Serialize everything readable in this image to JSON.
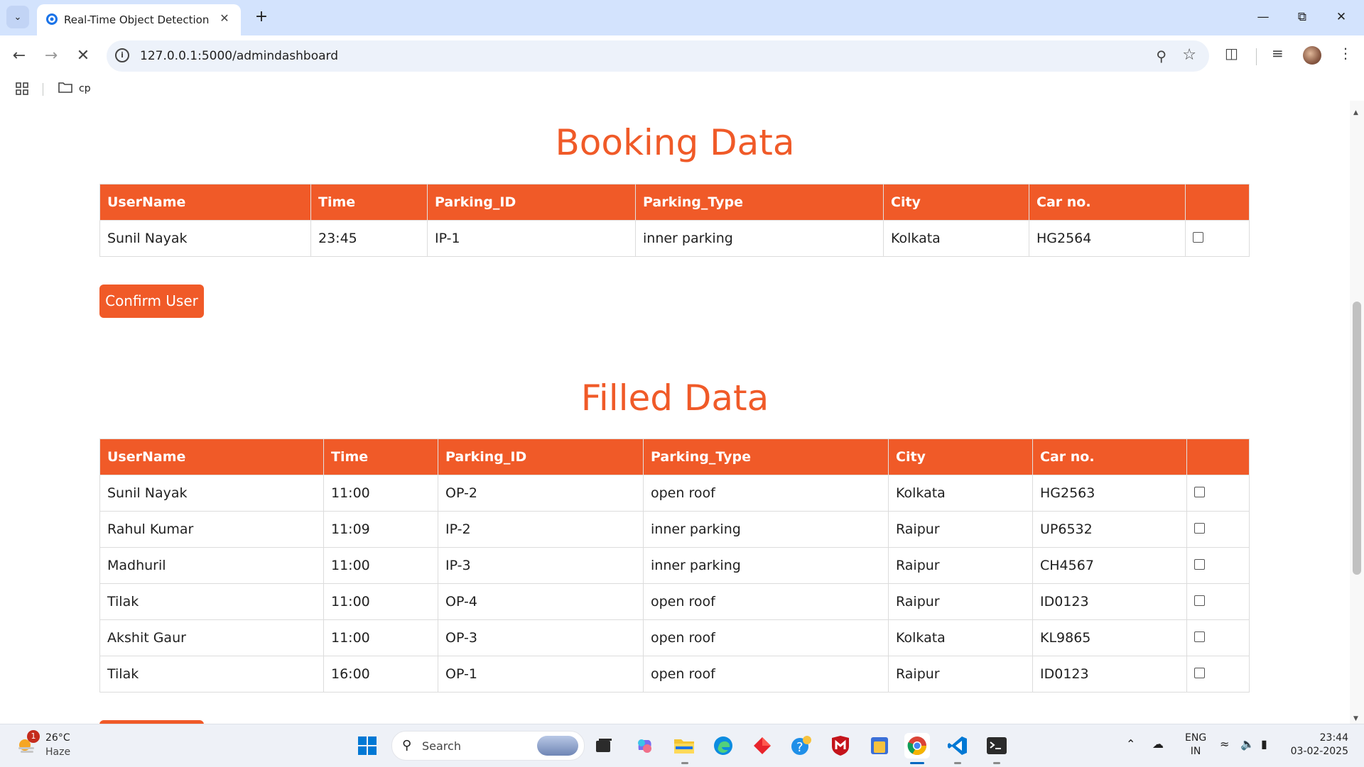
{
  "browser": {
    "tab_title": "Real-Time Object Detection",
    "url": "127.0.0.1:5000/admindashboard",
    "bookmark_folder": "cp"
  },
  "page": {
    "booking": {
      "title": "Booking Data",
      "columns": [
        "UserName",
        "Time",
        "Parking_ID",
        "Parking_Type",
        "City",
        "Car no.",
        ""
      ],
      "rows": [
        {
          "username": "Sunil Nayak",
          "time": "23:45",
          "parking_id": "IP-1",
          "parking_type": "inner parking",
          "city": "Kolkata",
          "car_no": "HG2564"
        }
      ],
      "confirm_button": "Confirm User"
    },
    "filled": {
      "title": "Filled Data",
      "columns": [
        "UserName",
        "Time",
        "Parking_ID",
        "Parking_Type",
        "City",
        "Car no.",
        ""
      ],
      "rows": [
        {
          "username": "Sunil Nayak",
          "time": "11:00",
          "parking_id": "OP-2",
          "parking_type": "open roof",
          "city": "Kolkata",
          "car_no": "HG2563"
        },
        {
          "username": "Rahul Kumar",
          "time": "11:09",
          "parking_id": "IP-2",
          "parking_type": "inner parking",
          "city": "Raipur",
          "car_no": "UP6532"
        },
        {
          "username": "Madhuril",
          "time": "11:00",
          "parking_id": "IP-3",
          "parking_type": "inner parking",
          "city": "Raipur",
          "car_no": "CH4567"
        },
        {
          "username": "Tilak",
          "time": "11:00",
          "parking_id": "OP-4",
          "parking_type": "open roof",
          "city": "Raipur",
          "car_no": "ID0123"
        },
        {
          "username": "Akshit Gaur",
          "time": "11:00",
          "parking_id": "OP-3",
          "parking_type": "open roof",
          "city": "Kolkata",
          "car_no": "KL9865"
        },
        {
          "username": "Tilak",
          "time": "16:00",
          "parking_id": "OP-1",
          "parking_type": "open roof",
          "city": "Raipur",
          "car_no": "ID0123"
        }
      ]
    }
  },
  "taskbar": {
    "weather_temp": "26°C",
    "weather_desc": "Haze",
    "weather_badge": "1",
    "search_label": "Search",
    "lang_line1": "ENG",
    "lang_line2": "IN",
    "time": "23:44",
    "date": "03-02-2025"
  },
  "colors": {
    "accent": "#f05a28",
    "tab_strip": "#d3e3fd",
    "omnibox": "#edf2fa"
  },
  "icons": {
    "browser": [
      "tab-search-icon",
      "close-icon",
      "new-tab-icon",
      "minimize-icon",
      "restore-icon",
      "close-window-icon",
      "back-icon",
      "forward-icon",
      "stop-loading-icon",
      "site-info-icon",
      "password-key-icon",
      "bookmark-star-icon",
      "extensions-icon",
      "media-control-icon",
      "profile-avatar",
      "menu-icon",
      "apps-grid-icon",
      "folder-icon"
    ],
    "taskbar": [
      "weather-icon",
      "windows-start-icon",
      "search-icon",
      "task-view-icon",
      "copilot-icon",
      "file-explorer-icon",
      "edge-icon",
      "app-red-diamond-icon",
      "help-icon",
      "mcafee-icon",
      "app-yellow-icon",
      "chrome-icon",
      "vscode-icon",
      "terminal-icon",
      "chevron-up-icon",
      "onedrive-icon",
      "wifi-icon",
      "volume-icon",
      "battery-icon"
    ]
  }
}
